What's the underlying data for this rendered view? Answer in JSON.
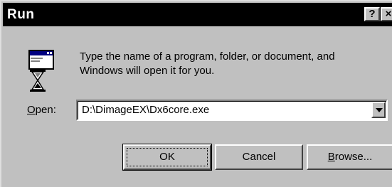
{
  "window": {
    "title": "Run",
    "help_label": "?",
    "close_label": "×"
  },
  "icon": {
    "name": "run-program-icon"
  },
  "message": {
    "line1": "Type the name of a program, folder, or document, and",
    "line2": "Windows will open it for you."
  },
  "open": {
    "label_accel": "O",
    "label_rest": "pen:",
    "value": "D:\\DimageEX\\Dx6core.exe"
  },
  "buttons": {
    "ok": "OK",
    "cancel": "Cancel",
    "browse_accel": "B",
    "browse_rest": "rowse..."
  },
  "colors": {
    "face": "#c0c0c0",
    "titlebar": "#000000",
    "title_text": "#ffffff",
    "field_bg": "#ffffff"
  }
}
